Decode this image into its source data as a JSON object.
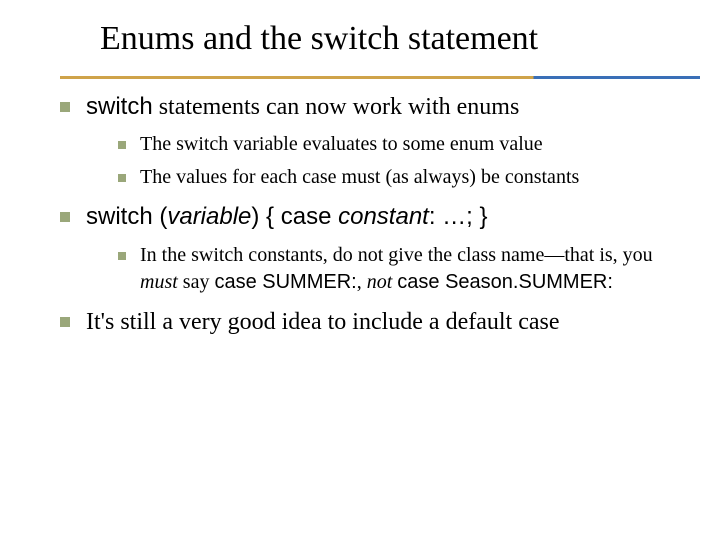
{
  "title": "Enums and the switch statement",
  "bullets": {
    "b1": {
      "prefix_sans": "switch",
      "rest": " statements can now work with enums",
      "sub": [
        "The switch variable evaluates to some enum value",
        "The values for each case must (as always) be constants"
      ]
    },
    "b2": {
      "prefix_sans": "switch (",
      "var_italic": "variable",
      "mid_sans": ") { case ",
      "const_italic": "constant",
      "end_sans": ": …; }",
      "sub1_a": "In the switch constants, do not give the class name—that is, you ",
      "sub1_must": "must",
      "sub1_b": " say ",
      "sub1_code1": "case SUMMER:",
      "sub1_c": ", ",
      "sub1_not": "not",
      "sub1_d": " ",
      "sub1_code2": "case Season.SUMMER:"
    },
    "b3": "It's still a very good idea to include a default case"
  }
}
